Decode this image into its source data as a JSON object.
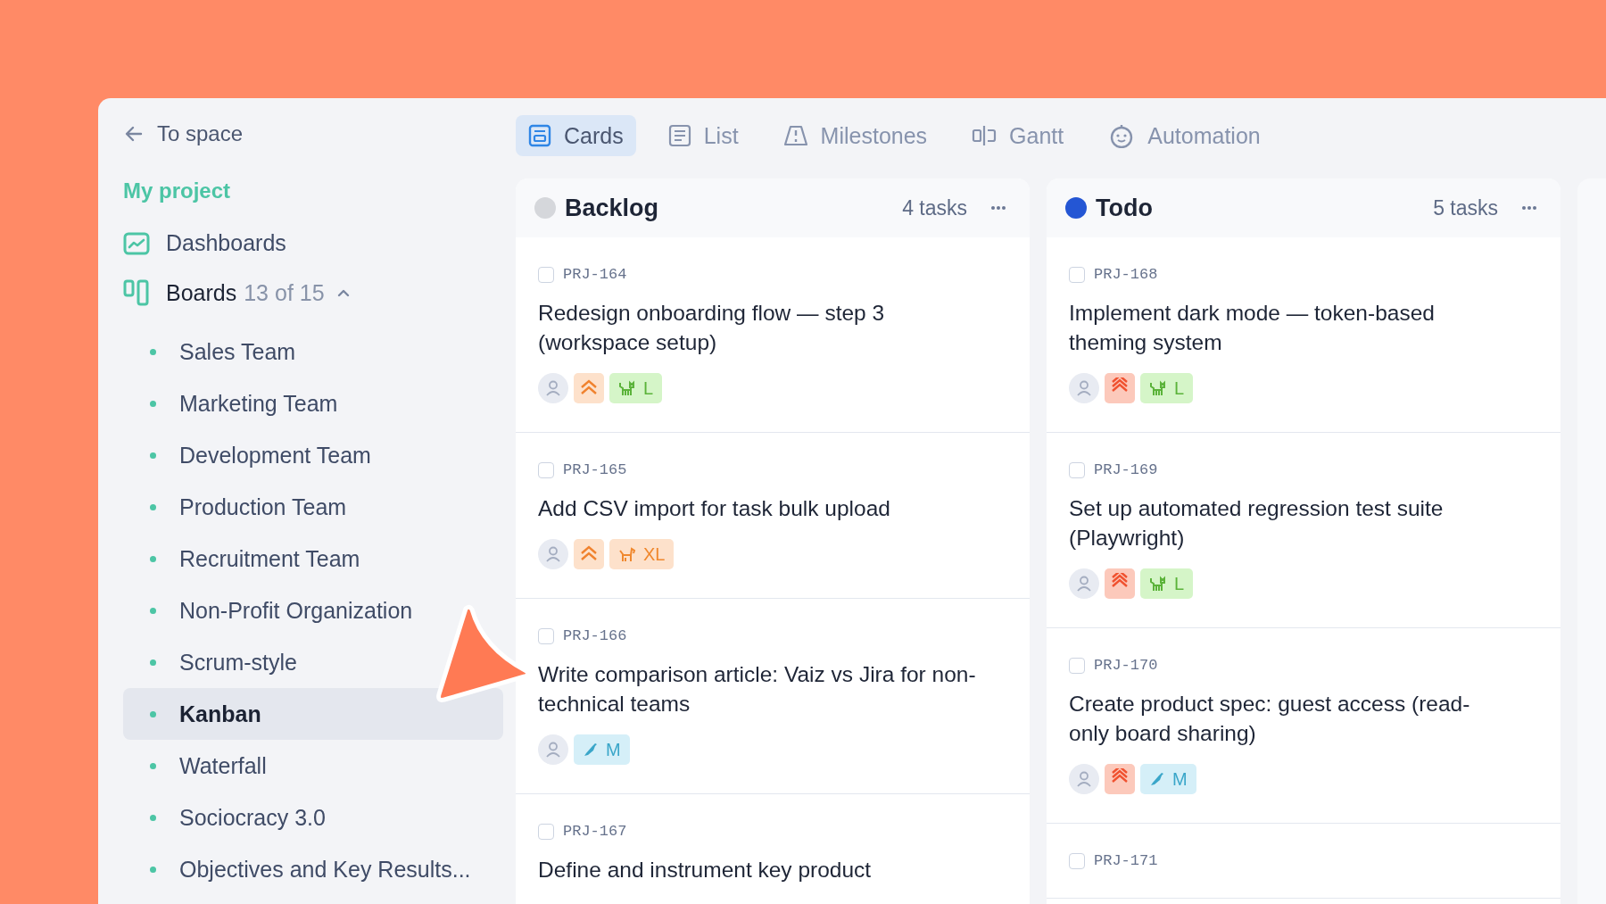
{
  "sidebar": {
    "back_link": "To space",
    "project": "My project",
    "dashboards": {
      "label": "Dashboards"
    },
    "boards": {
      "label": "Boards",
      "count": "13 of 15",
      "expanded": true,
      "items": [
        {
          "label": "Sales Team",
          "selected": false
        },
        {
          "label": "Marketing Team",
          "selected": false
        },
        {
          "label": "Development Team",
          "selected": false
        },
        {
          "label": "Production Team",
          "selected": false
        },
        {
          "label": "Recruitment Team",
          "selected": false
        },
        {
          "label": "Non-Profit Organization",
          "selected": false
        },
        {
          "label": "Scrum-style",
          "selected": false
        },
        {
          "label": "Kanban",
          "selected": true
        },
        {
          "label": "Waterfall",
          "selected": false
        },
        {
          "label": "Sociocracy 3.0",
          "selected": false
        },
        {
          "label": "Objectives and Key Results...",
          "selected": false
        }
      ]
    }
  },
  "tabs": [
    {
      "label": "Cards",
      "kind": "cards",
      "selected": true
    },
    {
      "label": "List",
      "kind": "list",
      "selected": false
    },
    {
      "label": "Milestones",
      "kind": "milestones",
      "selected": false
    },
    {
      "label": "Gantt",
      "kind": "gantt",
      "selected": false
    },
    {
      "label": "Automation",
      "kind": "automation",
      "selected": false
    }
  ],
  "columns": [
    {
      "title": "Backlog",
      "color": "#d5d7db",
      "count": "4 tasks",
      "cards": [
        {
          "id": "PRJ-164",
          "checked": false,
          "title": "Redesign onboarding flow — step 3 (workspace setup)",
          "priority": {
            "kind": "high"
          },
          "size": {
            "label": "L",
            "kind": "cat"
          }
        },
        {
          "id": "PRJ-165",
          "checked": false,
          "title": "Add CSV import for task bulk upload",
          "priority": {
            "kind": "high"
          },
          "size": {
            "label": "XL",
            "kind": "dog"
          }
        },
        {
          "id": "PRJ-166",
          "checked": false,
          "title": "Write comparison article: Vaiz vs Jira for non-technical teams",
          "size": {
            "label": "M",
            "kind": "bird"
          }
        },
        {
          "id": "PRJ-167",
          "checked": false,
          "title": "Define and instrument key product"
        }
      ]
    },
    {
      "title": "Todo",
      "color": "#2456d4",
      "count": "5 tasks",
      "cards": [
        {
          "id": "PRJ-168",
          "checked": false,
          "title": "Implement dark mode — token-based theming system",
          "priority": {
            "kind": "urgent"
          },
          "size": {
            "label": "L",
            "kind": "cat"
          }
        },
        {
          "id": "PRJ-169",
          "checked": false,
          "title": "Set up automated regression test suite (Playwright)",
          "priority": {
            "kind": "urgent"
          },
          "size": {
            "label": "L",
            "kind": "cat"
          }
        },
        {
          "id": "PRJ-170",
          "checked": false,
          "title": "Create product spec: guest access (read-only board sharing)",
          "priority": {
            "kind": "urgent"
          },
          "size": {
            "label": "M",
            "kind": "bird"
          }
        },
        {
          "id": "PRJ-171",
          "checked": false
        }
      ]
    }
  ]
}
